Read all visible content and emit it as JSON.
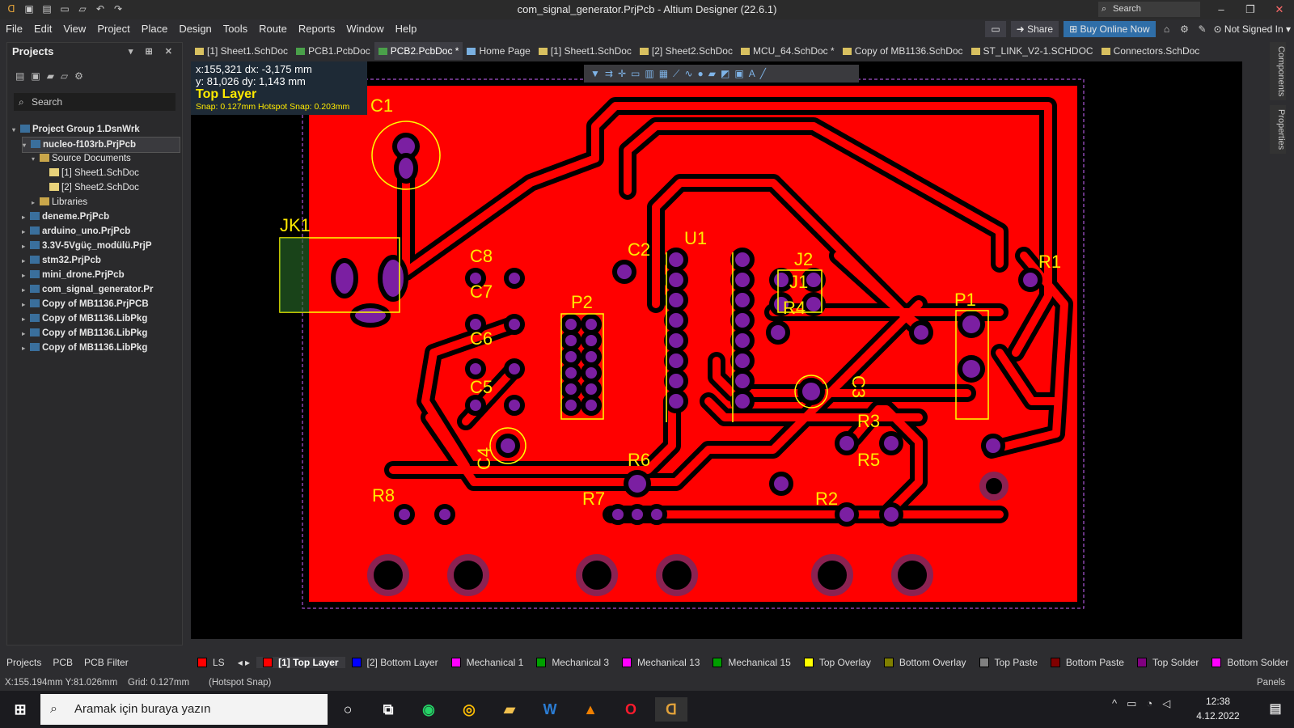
{
  "title_bar": {
    "title": "com_signal_generator.PrjPcb - Altium Designer (22.6.1)",
    "search_placeholder": "Search",
    "quick_access_icons": [
      "altium-logo-icon",
      "save-icon",
      "save-all-icon",
      "open-icon",
      "open-project-icon",
      "undo-icon",
      "redo-icon"
    ]
  },
  "menu": {
    "items": [
      "File",
      "Edit",
      "View",
      "Project",
      "Place",
      "Design",
      "Tools",
      "Route",
      "Reports",
      "Window",
      "Help"
    ],
    "share_label": "Share",
    "buy_label": "Buy Online Now",
    "account_label": "Not Signed In"
  },
  "projects_panel": {
    "title": "Projects",
    "search_placeholder": "Search",
    "tree": [
      {
        "label": "Project Group 1.DsnWrk",
        "type": "group",
        "level": 0
      },
      {
        "label": "nucleo-f103rb.PrjPcb",
        "type": "project",
        "level": 1,
        "selected": true
      },
      {
        "label": "Source Documents",
        "type": "folder",
        "level": 2
      },
      {
        "label": "[1] Sheet1.SchDoc",
        "type": "doc",
        "level": 3
      },
      {
        "label": "[2] Sheet2.SchDoc",
        "type": "doc",
        "level": 3
      },
      {
        "label": "Libraries",
        "type": "folder",
        "level": 2
      },
      {
        "label": "deneme.PrjPcb",
        "type": "project",
        "level": 1
      },
      {
        "label": "arduino_uno.PrjPcb",
        "type": "project",
        "level": 1
      },
      {
        "label": "3.3V-5Vgüç_modülü.PrjP",
        "type": "project",
        "level": 1
      },
      {
        "label": "stm32.PrjPcb",
        "type": "project",
        "level": 1
      },
      {
        "label": "mini_drone.PrjPcb",
        "type": "project",
        "level": 1
      },
      {
        "label": "com_signal_generator.Pr",
        "type": "project",
        "level": 1
      },
      {
        "label": "Copy of MB1136.PrjPCB",
        "type": "project",
        "level": 1
      },
      {
        "label": "Copy of MB1136.LibPkg",
        "type": "project",
        "level": 1
      },
      {
        "label": "Copy of MB1136.LibPkg",
        "type": "project",
        "level": 1
      },
      {
        "label": "Copy of MB1136.LibPkg",
        "type": "project",
        "level": 1
      }
    ],
    "bottom_tabs": [
      "Projects",
      "PCB",
      "PCB Filter"
    ]
  },
  "doc_tabs": [
    {
      "label": "[1] Sheet1.SchDoc",
      "kind": "sch"
    },
    {
      "label": "PCB1.PcbDoc",
      "kind": "pcb"
    },
    {
      "label": "PCB2.PcbDoc *",
      "kind": "pcb",
      "active": true
    },
    {
      "label": "Home Page",
      "kind": "home"
    },
    {
      "label": "[1] Sheet1.SchDoc",
      "kind": "sch"
    },
    {
      "label": "[2] Sheet2.SchDoc",
      "kind": "sch"
    },
    {
      "label": "MCU_64.SchDoc *",
      "kind": "sch"
    },
    {
      "label": "Copy of MB1136.SchDoc",
      "kind": "sch"
    },
    {
      "label": "ST_LINK_V2-1.SCHDOC",
      "kind": "sch"
    },
    {
      "label": "Connectors.SchDoc",
      "kind": "sch"
    }
  ],
  "hud": {
    "line1": "x:155,321   dx: -3,175 mm",
    "line2": "y: 81,026    dy:  1,143 mm",
    "layer": "Top Layer",
    "snap": "Snap: 0.127mm Hotspot Snap: 0.203mm"
  },
  "pcb_labels": [
    "C1",
    "JK1",
    "C8",
    "C7",
    "C6",
    "C5",
    "C4",
    "C2",
    "U1",
    "J2",
    "J1",
    "R4",
    "P2",
    "C3",
    "R1",
    "P1",
    "R3",
    "R5",
    "R2",
    "R6",
    "R7",
    "R8"
  ],
  "right_strip": [
    "Components",
    "Properties"
  ],
  "layer_tabs": [
    {
      "label": "LS",
      "color": "#ff0000"
    },
    {
      "label": "[1] Top Layer",
      "color": "#ff0000",
      "active": true
    },
    {
      "label": "[2] Bottom Layer",
      "color": "#0000ff"
    },
    {
      "label": "Mechanical 1",
      "color": "#ff00ff"
    },
    {
      "label": "Mechanical 3",
      "color": "#00a000"
    },
    {
      "label": "Mechanical 13",
      "color": "#ff00ff"
    },
    {
      "label": "Mechanical 15",
      "color": "#00a000"
    },
    {
      "label": "Top Overlay",
      "color": "#ffff00"
    },
    {
      "label": "Bottom Overlay",
      "color": "#808000"
    },
    {
      "label": "Top Paste",
      "color": "#808080"
    },
    {
      "label": "Bottom Paste",
      "color": "#800000"
    },
    {
      "label": "Top Solder",
      "color": "#800080"
    },
    {
      "label": "Bottom Solder",
      "color": "#ff00ff"
    }
  ],
  "status": {
    "coords": "X:155.194mm Y:81.026mm",
    "grid": "Grid: 0.127mm",
    "snap": "(Hotspot Snap)",
    "panels": "Panels"
  },
  "taskbar": {
    "search_placeholder": "Aramak için buraya yazın",
    "time": "12:38",
    "date": "4.12.2022"
  },
  "colors": {
    "copper": "#ff0000",
    "overlay": "#ffff00",
    "pad": "#7b1fa2",
    "board_bg": "#000000"
  }
}
